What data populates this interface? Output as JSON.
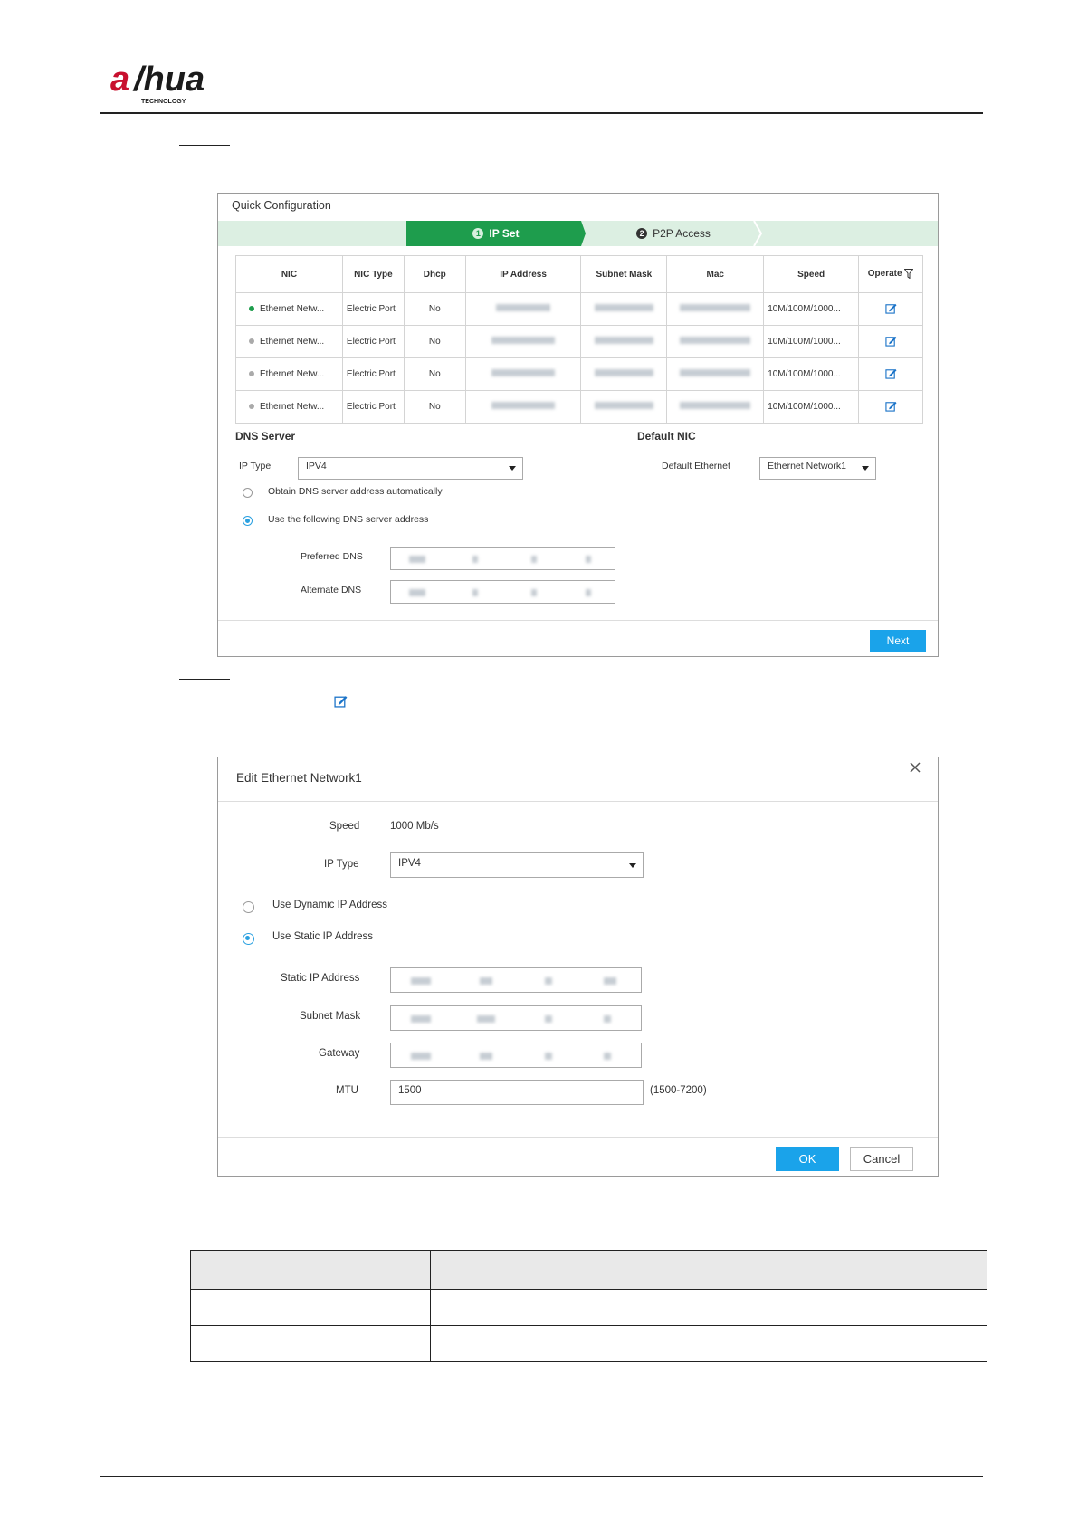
{
  "logo": {
    "brand": "alhua",
    "sub": "TECHNOLOGY"
  },
  "quick_config": {
    "title": "Quick Configuration",
    "steps": [
      {
        "num": "1",
        "label": "IP Set"
      },
      {
        "num": "2",
        "label": "P2P Access"
      }
    ],
    "columns": [
      "NIC",
      "NIC Type",
      "Dhcp",
      "IP Address",
      "Subnet Mask",
      "Mac",
      "Speed",
      "Operate"
    ],
    "rows": [
      {
        "status_color": "#1e9d4d",
        "nic": "Ethernet Netw...",
        "type": "Electric Port",
        "dhcp": "No",
        "speed": "10M/100M/1000..."
      },
      {
        "status_color": "#aaaaaa",
        "nic": "Ethernet Netw...",
        "type": "Electric Port",
        "dhcp": "No",
        "speed": "10M/100M/1000..."
      },
      {
        "status_color": "#aaaaaa",
        "nic": "Ethernet Netw...",
        "type": "Electric Port",
        "dhcp": "No",
        "speed": "10M/100M/1000..."
      },
      {
        "status_color": "#aaaaaa",
        "nic": "Ethernet Netw...",
        "type": "Electric Port",
        "dhcp": "No",
        "speed": "10M/100M/1000..."
      }
    ],
    "dns": {
      "heading": "DNS Server",
      "ip_type_label": "IP Type",
      "ip_type_value": "IPV4",
      "auto_label": "Obtain DNS server address automatically",
      "manual_label": "Use the following DNS server address",
      "preferred_label": "Preferred DNS",
      "alternate_label": "Alternate DNS"
    },
    "default_nic": {
      "heading": "Default NIC",
      "label": "Default Ethernet",
      "value": "Ethernet Network1"
    },
    "next_label": "Next"
  },
  "edit": {
    "title": "Edit Ethernet Network1",
    "speed_label": "Speed",
    "speed_value": "1000 Mb/s",
    "ip_type_label": "IP Type",
    "ip_type_value": "IPV4",
    "dynamic_label": "Use Dynamic IP Address",
    "static_label": "Use Static IP Address",
    "static_ip_label": "Static IP Address",
    "subnet_label": "Subnet Mask",
    "gateway_label": "Gateway",
    "mtu_label": "MTU",
    "mtu_value": "1500",
    "mtu_range": "(1500-7200)",
    "ok_label": "OK",
    "cancel_label": "Cancel"
  },
  "colors": {
    "accent_green": "#1e9d4d",
    "accent_blue": "#1aa3ea",
    "step_bar": "#dcefe2"
  }
}
